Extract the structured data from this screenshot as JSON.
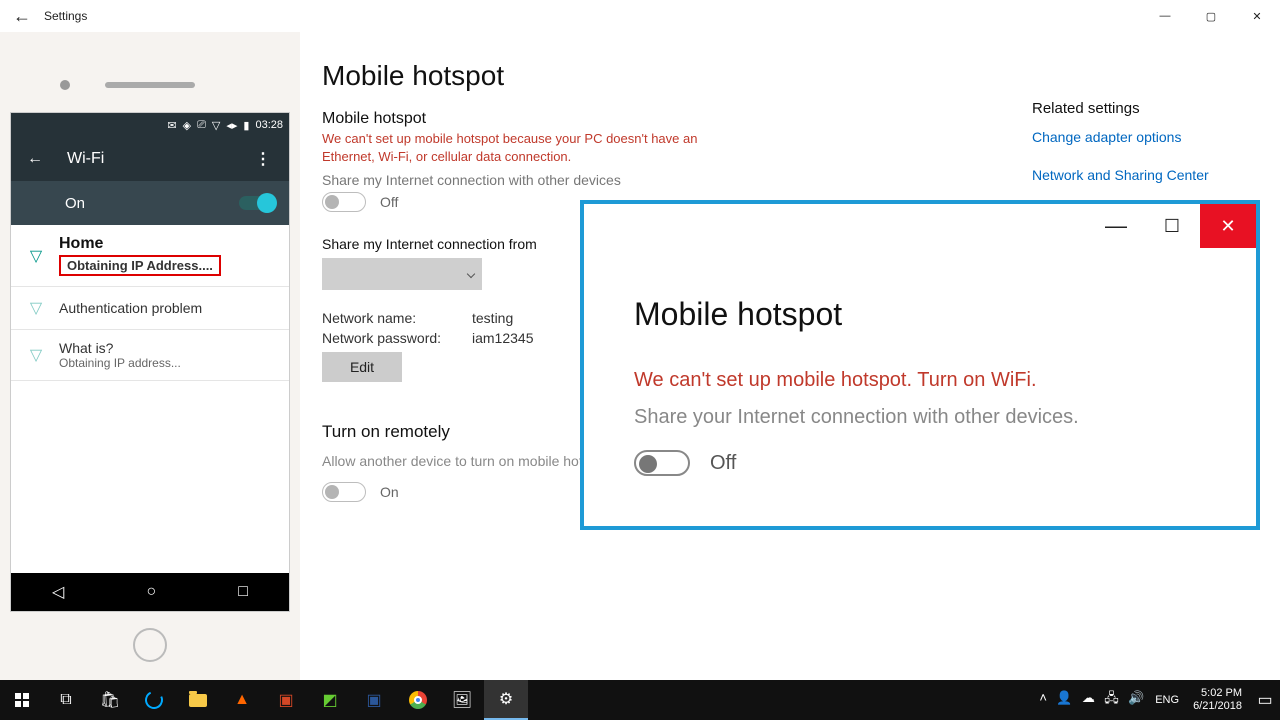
{
  "window": {
    "title": "Settings"
  },
  "phone": {
    "status_time": "03:28",
    "wifi_title": "Wi-Fi",
    "wifi_state": "On",
    "networks": [
      {
        "name": "Home",
        "sub": "Obtaining IP Address....",
        "highlight": true
      },
      {
        "name": "",
        "sub": "Authentication problem"
      },
      {
        "name": "What is?",
        "sub": "Obtaining IP address..."
      }
    ]
  },
  "main": {
    "title": "Mobile hotspot",
    "section1_label": "Mobile hotspot",
    "warn": "We can't set up mobile hotspot because your PC doesn't have an Ethernet, Wi-Fi, or cellular data connection.",
    "share_label": "Share my Internet connection with other devices",
    "toggle1_state": "Off",
    "share_from_label": "Share my Internet connection from",
    "net_name_label": "Network name:",
    "net_name_value": "testing",
    "net_pass_label": "Network password:",
    "net_pass_value": "iam12345",
    "edit_label": "Edit",
    "remote_title": "Turn on remotely",
    "remote_desc": "Allow another device to turn on mobile hotspot. Both devices must have Bluetooth turned on and be paired.",
    "remote_state": "On"
  },
  "related": {
    "heading": "Related settings",
    "links": [
      "Change adapter options",
      "Network and Sharing Center"
    ]
  },
  "popup": {
    "title": "Mobile hotspot",
    "warn": "We can't set up mobile hotspot. Turn on WiFi.",
    "share": "Share your Internet connection with other devices.",
    "state": "Off"
  },
  "taskbar": {
    "lang": "ENG",
    "time": "5:02 PM",
    "date": "6/21/2018"
  }
}
